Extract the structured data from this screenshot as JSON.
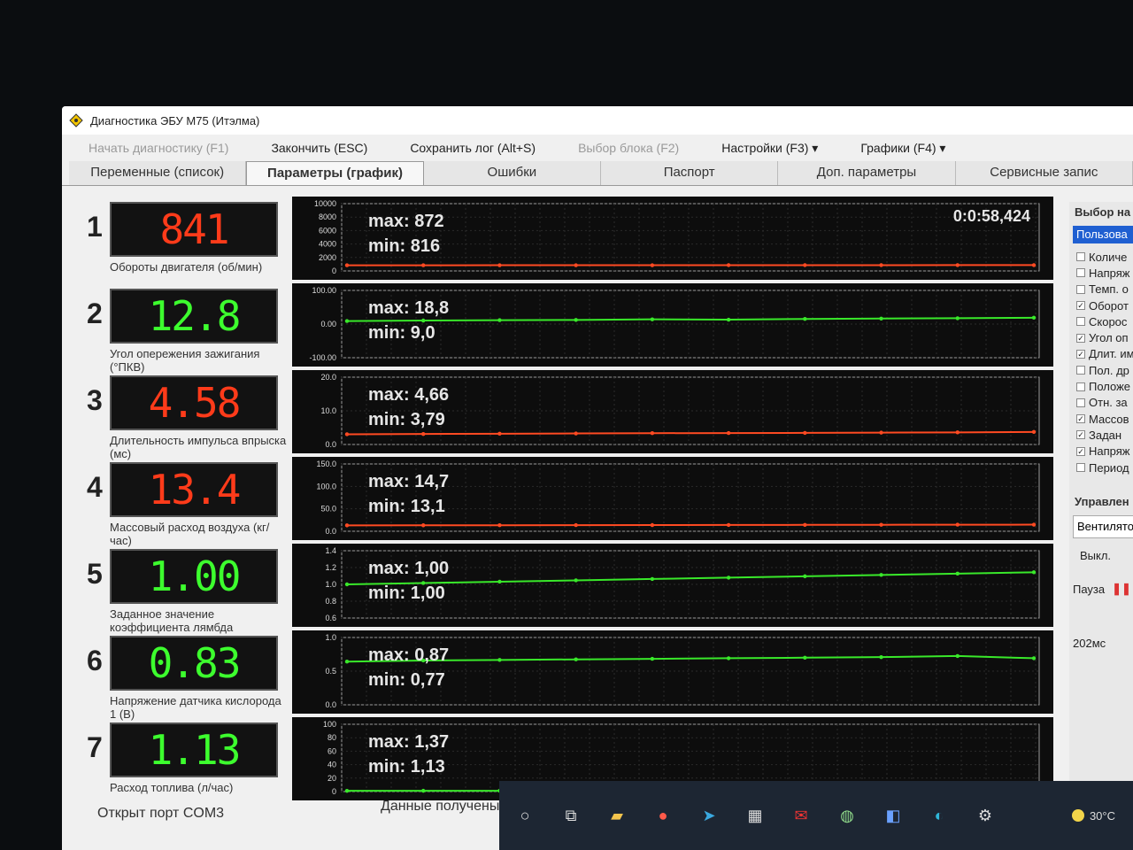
{
  "window": {
    "title": "Диагностика ЭБУ М75 (Итэлма)"
  },
  "menu": [
    {
      "label": "Начать диагностику (F1)",
      "disabled": true
    },
    {
      "label": "Закончить (ESC)",
      "disabled": false
    },
    {
      "label": "Сохранить лог (Alt+S)",
      "disabled": false
    },
    {
      "label": "Выбор блока (F2)",
      "disabled": true
    },
    {
      "label": "Настройки (F3) ▾",
      "disabled": false
    },
    {
      "label": "Графики (F4) ▾",
      "disabled": false
    }
  ],
  "tabs": [
    {
      "label": "Переменные (список)",
      "active": false
    },
    {
      "label": "Параметры (график)",
      "active": true
    },
    {
      "label": "Ошибки",
      "active": false
    },
    {
      "label": "Паспорт",
      "active": false
    },
    {
      "label": "Доп. параметры",
      "active": false
    },
    {
      "label": "Сервисные запис",
      "active": false
    }
  ],
  "timer": "0:0:58,424",
  "params": [
    {
      "num": "1",
      "display": "841",
      "color": "red",
      "caption": "Обороты двигателя (об/мин)",
      "max": "max: 872",
      "min": "min: 816",
      "ticks": [
        "10000",
        "8000",
        "6000",
        "4000",
        "2000",
        "0"
      ],
      "chart_data": {
        "type": "line",
        "ylim": [
          0,
          10000
        ],
        "values": [
          841,
          845,
          850,
          848,
          852,
          860,
          858,
          862,
          866,
          870
        ]
      }
    },
    {
      "num": "2",
      "display": "12.8",
      "color": "green",
      "caption": "Угол опережения зажигания (°ПКВ)",
      "max": "max: 18,8",
      "min": "min: 9,0",
      "ticks": [
        "100.00",
        "0.00",
        "-100.00"
      ],
      "chart_data": {
        "type": "line",
        "ylim": [
          -100,
          100
        ],
        "values": [
          9.0,
          10.5,
          11.6,
          12.2,
          14.1,
          13.0,
          15.2,
          16.4,
          17.3,
          18.8
        ]
      }
    },
    {
      "num": "3",
      "display": "4.58",
      "color": "red",
      "caption": "Длительность импульса впрыска (мс)",
      "max": "max: 4,66",
      "min": "min: 3,79",
      "ticks": [
        "20.0",
        "10.0",
        "0.0"
      ],
      "chart_data": {
        "type": "line",
        "ylim": [
          0,
          25
        ],
        "values": [
          3.79,
          3.9,
          4.0,
          4.1,
          4.2,
          4.25,
          4.3,
          4.4,
          4.5,
          4.66
        ]
      }
    },
    {
      "num": "4",
      "display": "13.4",
      "color": "red",
      "caption": "Массовый расход воздуха (кг/час)",
      "max": "max: 14,7",
      "min": "min: 13,1",
      "ticks": [
        "150.0",
        "100.0",
        "50.0",
        "0.0"
      ],
      "chart_data": {
        "type": "line",
        "ylim": [
          0,
          150
        ],
        "values": [
          13.1,
          13.3,
          13.4,
          13.6,
          13.8,
          14.0,
          14.2,
          14.4,
          14.6,
          14.7
        ]
      }
    },
    {
      "num": "5",
      "display": "1.00",
      "color": "green",
      "caption": "Заданное значение коэффициента лямбда",
      "max": "max: 1,00",
      "min": "min: 1,00",
      "ticks": [
        "1.4",
        "1.2",
        "1.0",
        "0.8",
        "0.6"
      ],
      "chart_data": {
        "type": "line",
        "ylim": [
          0.5,
          1.5
        ],
        "values": [
          1.0,
          1.02,
          1.04,
          1.06,
          1.08,
          1.1,
          1.12,
          1.14,
          1.16,
          1.18
        ]
      }
    },
    {
      "num": "6",
      "display": "0.83",
      "color": "green",
      "caption": "Напряжение датчика кислорода 1 (В)",
      "max": "max: 0,87",
      "min": "min: 0,77",
      "ticks": [
        "1.0",
        "0.5",
        "0.0"
      ],
      "chart_data": {
        "type": "line",
        "ylim": [
          0,
          1.2
        ],
        "values": [
          0.77,
          0.79,
          0.8,
          0.81,
          0.82,
          0.83,
          0.84,
          0.85,
          0.87,
          0.83
        ]
      }
    },
    {
      "num": "7",
      "display": "1.13",
      "color": "green",
      "caption": "Расход топлива (л/час)",
      "max": "max: 1,37",
      "min": "min: 1,13",
      "ticks": [
        "100",
        "80",
        "60",
        "40",
        "20",
        "0"
      ],
      "chart_data": {
        "type": "line",
        "ylim": [
          0,
          100
        ],
        "values": [
          1.13,
          1.16,
          1.18,
          1.2,
          1.23,
          1.26,
          1.29,
          1.32,
          1.35,
          1.37
        ]
      }
    }
  ],
  "right_panel": {
    "title": "Выбор на",
    "selected": "Пользова",
    "items": [
      {
        "label": "Количе",
        "checked": false
      },
      {
        "label": "Напряж",
        "checked": false
      },
      {
        "label": "Темп. о",
        "checked": false
      },
      {
        "label": "Оборот",
        "checked": true
      },
      {
        "label": "Скорос",
        "checked": false
      },
      {
        "label": "Угол оп",
        "checked": true
      },
      {
        "label": "Длит. им",
        "checked": true
      },
      {
        "label": "Пол. др",
        "checked": false
      },
      {
        "label": "Положе",
        "checked": false
      },
      {
        "label": "Отн. за",
        "checked": false
      },
      {
        "label": "Массов",
        "checked": true
      },
      {
        "label": "Задан",
        "checked": true
      },
      {
        "label": "Напряж",
        "checked": true
      },
      {
        "label": "Период",
        "checked": false
      }
    ],
    "control_title": "Управлен",
    "fan_label": "Вентилято",
    "off_button": "Выкл.",
    "pause_label": "Пауза",
    "interval": "202мс"
  },
  "status": {
    "left": "Открыт порт COM3",
    "mid": "Данные получены"
  },
  "taskbar": {
    "temperature": "30°C"
  }
}
